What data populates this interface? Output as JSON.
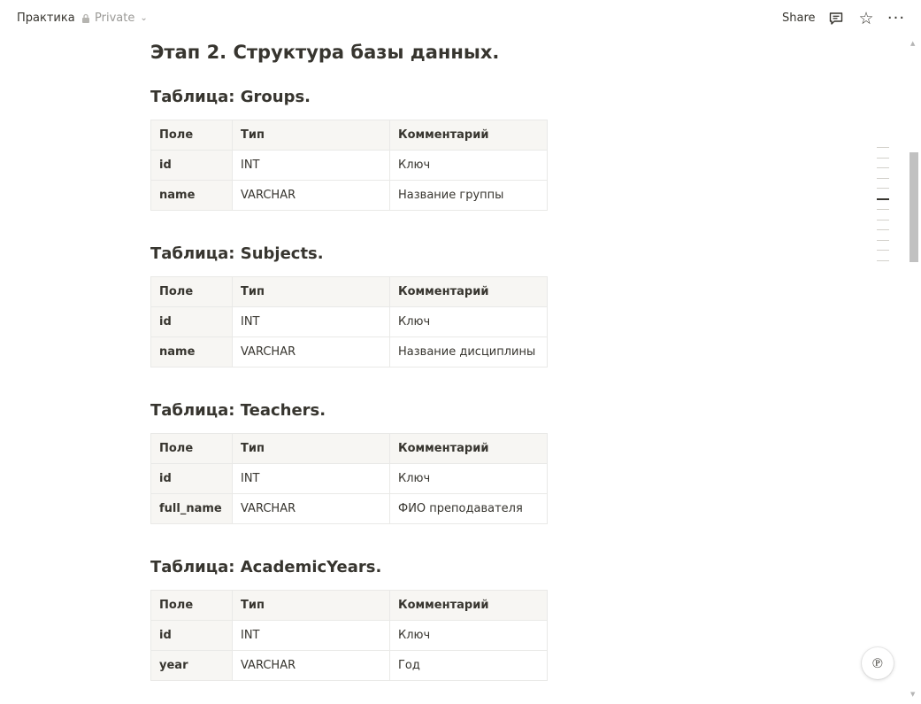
{
  "topbar": {
    "breadcrumb": "Практика",
    "privacy_label": "Private",
    "share_label": "Share",
    "icons": [
      "comment-icon",
      "star-icon",
      "more-icon"
    ]
  },
  "page": {
    "title": "Этап 2. Структура базы данных."
  },
  "tables": [
    {
      "title": "Таблица: Groups.",
      "header": [
        "Поле",
        "Тип",
        "Комментарий"
      ],
      "rows": [
        [
          "id",
          "INT",
          "Ключ"
        ],
        [
          "name",
          "VARCHAR",
          "Название группы"
        ]
      ]
    },
    {
      "title": "Таблица: Subjects.",
      "header": [
        "Поле",
        "Тип",
        "Комментарий"
      ],
      "rows": [
        [
          "id",
          "INT",
          "Ключ"
        ],
        [
          "name",
          "VARCHAR",
          "Название дисциплины"
        ]
      ]
    },
    {
      "title": "Таблица: Teachers.",
      "header": [
        "Поле",
        "Тип",
        "Комментарий"
      ],
      "rows": [
        [
          "id",
          "INT",
          "Ключ"
        ],
        [
          "full_name",
          "VARCHAR",
          "ФИО преподавателя"
        ]
      ]
    },
    {
      "title": "Таблица: AcademicYears.",
      "header": [
        "Поле",
        "Тип",
        "Комментарий"
      ],
      "rows": [
        [
          "id",
          "INT",
          "Ключ"
        ],
        [
          "year",
          "VARCHAR",
          "Год"
        ]
      ]
    }
  ],
  "colors": {
    "text": "#37352f",
    "muted": "#9b9a97",
    "header_bg": "#f7f6f3",
    "border": "#e9e9e7"
  }
}
